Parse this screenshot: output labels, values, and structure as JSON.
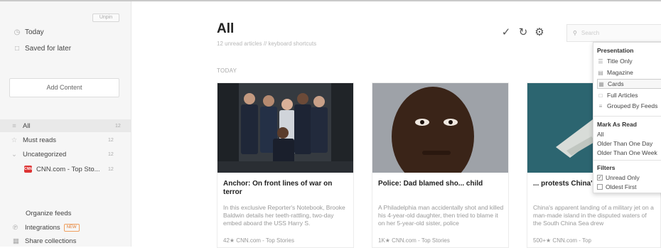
{
  "sidebar": {
    "unpin_label": "Unpin",
    "nav": [
      {
        "icon": "clock-icon",
        "label": "Today"
      },
      {
        "icon": "bookmark-icon",
        "label": "Saved for later"
      }
    ],
    "add_content_label": "Add Content",
    "feeds": [
      {
        "icon": "list-icon",
        "label": "All",
        "count": "12"
      },
      {
        "icon": "star-icon",
        "label": "Must reads",
        "count": "12"
      },
      {
        "icon": "chevron-down-icon",
        "label": "Uncategorized",
        "count": "12"
      },
      {
        "icon": "cnn-logo-icon",
        "label": "CNN.com - Top Sto...",
        "count": "12"
      }
    ],
    "organize_label": "Organize feeds",
    "integrations_label": "Integrations",
    "new_badge": "NEW",
    "share_label": "Share collections"
  },
  "header": {
    "title": "All",
    "subtitle": "12 unread articles  //  keyboard shortcuts",
    "section": "TODAY",
    "search_placeholder": "Search"
  },
  "cards": [
    {
      "title": "Anchor: On front lines of war on terror",
      "excerpt": "In this exclusive Reporter's Notebook, Brooke Baldwin details her teeth-rattling, two-day embed aboard the USS Harry S.",
      "meta": "42★ CNN.com - Top Stories"
    },
    {
      "title": "Police: Dad blamed sho... child",
      "excerpt": "A Philadelphia man accidentally shot and killed his 4-year-old daughter, then tried to blame it on her 5-year-old sister, police",
      "meta": "1K★ CNN.com - Top Stories"
    },
    {
      "title": "... protests China's use of jet",
      "excerpt": "China's apparent landing of a military jet on a man-made island in the disputed waters of the South China Sea drew",
      "meta": "500+★ CNN.com - Top"
    }
  ],
  "menu": {
    "presentation_header": "Presentation",
    "presentation_items": [
      {
        "icon": "title-only-icon",
        "label": "Title Only"
      },
      {
        "icon": "magazine-icon",
        "label": "Magazine"
      },
      {
        "icon": "cards-icon",
        "label": "Cards"
      },
      {
        "icon": "full-articles-icon",
        "label": "Full Articles"
      },
      {
        "icon": "grouped-feeds-icon",
        "label": "Grouped By Feeds"
      }
    ],
    "mark_header": "Mark As Read",
    "mark_items": [
      "All",
      "Older Than One Day",
      "Older Than One Week"
    ],
    "filters_header": "Filters",
    "filters": [
      {
        "label": "Unread Only",
        "checked": true
      },
      {
        "label": "Oldest First",
        "checked": false
      }
    ]
  }
}
